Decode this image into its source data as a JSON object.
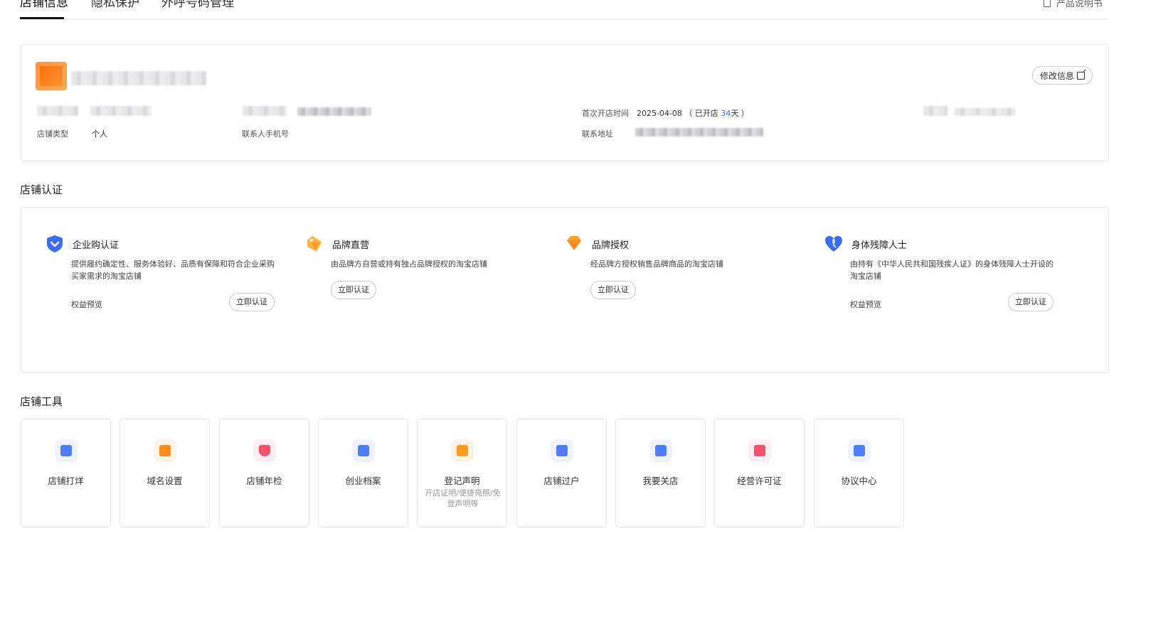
{
  "tabs": [
    {
      "label": "店铺信息",
      "active": true
    },
    {
      "label": "隐私保护",
      "active": false
    },
    {
      "label": "外呼号码管理",
      "active": false
    }
  ],
  "manual_link": "产品说明书",
  "info": {
    "edit_label": "修改信息",
    "shop_type_label": "店铺类型",
    "shop_type_value": "个人",
    "contact_phone_label": "联系人手机号",
    "open_time_label": "首次开店时间",
    "open_date": "2025-04-08",
    "open_days_prefix": "（ 已开店 ",
    "open_days": "34",
    "open_days_suffix": "天 ）",
    "address_label": "联系地址"
  },
  "certification": {
    "title": "店铺认证",
    "items": [
      {
        "name": "企业购认证",
        "desc": "提供履约确定性、服务体验好、品质有保障和符合企业采购买家需求的淘宝店铺",
        "perk": "权益预览",
        "button": "立即认证",
        "icon": "shield-check-icon",
        "color": "#3b6cf6"
      },
      {
        "name": "品牌直营",
        "desc": "由品牌方自营或持有独占品牌授权的淘宝店铺",
        "perk": "",
        "button": "立即认证",
        "icon": "tag-icon",
        "color": "#ff9a1f"
      },
      {
        "name": "品牌授权",
        "desc": "经品牌方授权销售品牌商品的淘宝店铺",
        "perk": "",
        "button": "立即认证",
        "icon": "diamond-icon",
        "color": "#ff9a1f"
      },
      {
        "name": "身体残障人士",
        "desc": "由持有《中华人民共和国残疾人证》的身体残障人士开设的淘宝店铺",
        "perk": "权益预览",
        "button": "立即认证",
        "icon": "heart-accessibility-icon",
        "color": "#3b6cf6"
      }
    ]
  },
  "tools": {
    "title": "店铺工具",
    "items": [
      {
        "name": "店铺打烊",
        "sub": "",
        "icon": "shop-close-icon",
        "color": "#4f7cf7"
      },
      {
        "name": "域名设置",
        "sub": "",
        "icon": "domain-icon",
        "color": "#ff8a1f"
      },
      {
        "name": "店铺年检",
        "sub": "",
        "icon": "inspection-shield-icon",
        "color": "#f4516c"
      },
      {
        "name": "创业档案",
        "sub": "",
        "icon": "archive-icon",
        "color": "#4f7cf7"
      },
      {
        "name": "登记声明",
        "sub": "开店证明/便捷亮照/免登声明等",
        "icon": "declaration-icon",
        "color": "#ff9a1f"
      },
      {
        "name": "店铺过户",
        "sub": "",
        "icon": "transfer-icon",
        "color": "#4f7cf7"
      },
      {
        "name": "我要关店",
        "sub": "",
        "icon": "close-shop-icon",
        "color": "#4f7cf7"
      },
      {
        "name": "经营许可证",
        "sub": "",
        "icon": "license-folder-icon",
        "color": "#f4516c"
      },
      {
        "name": "协议中心",
        "sub": "",
        "icon": "agreement-icon",
        "color": "#4f7cf7"
      }
    ]
  }
}
